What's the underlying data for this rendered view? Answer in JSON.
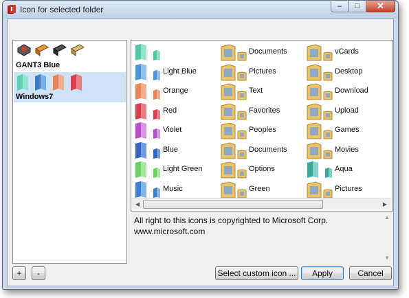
{
  "window": {
    "title": "Icon for selected folder",
    "minimize": "–",
    "maximize": "□",
    "close": "✕"
  },
  "themes": [
    {
      "name": "GANT3 Blue",
      "selected": false
    },
    {
      "name": "Windows7",
      "selected": true
    }
  ],
  "icon_grid": [
    {
      "label": "",
      "icon": "folder-teal-icon"
    },
    {
      "label": "Documents",
      "icon": "folder-documents-icon"
    },
    {
      "label": "vCards",
      "icon": "folder-vcards-icon"
    },
    {
      "label": "Light Blue",
      "icon": "folder-lightblue-icon"
    },
    {
      "label": "Pictures",
      "icon": "folder-pictures-icon"
    },
    {
      "label": "Desktop",
      "icon": "folder-desktop-icon"
    },
    {
      "label": "Orange",
      "icon": "folder-orange-icon"
    },
    {
      "label": "Text",
      "icon": "folder-text-icon"
    },
    {
      "label": "Download",
      "icon": "folder-download-icon"
    },
    {
      "label": "Red",
      "icon": "folder-red-icon"
    },
    {
      "label": "Favorites",
      "icon": "folder-favorites-icon"
    },
    {
      "label": "Upload",
      "icon": "folder-upload-icon"
    },
    {
      "label": "Violet",
      "icon": "folder-violet-icon"
    },
    {
      "label": "Peoples",
      "icon": "folder-peoples-icon"
    },
    {
      "label": "Games",
      "icon": "folder-games-icon"
    },
    {
      "label": "Blue",
      "icon": "folder-blue-icon"
    },
    {
      "label": "Documents",
      "icon": "folder-documents-icon"
    },
    {
      "label": "Movies",
      "icon": "folder-movies-icon"
    },
    {
      "label": "Light Green",
      "icon": "folder-lightgreen-icon"
    },
    {
      "label": "Options",
      "icon": "folder-options-icon"
    },
    {
      "label": "Aqua",
      "icon": "folder-aqua-icon"
    },
    {
      "label": "Music",
      "icon": "folder-music-icon"
    },
    {
      "label": "Green",
      "icon": "folder-green-icon"
    },
    {
      "label": "Pictures",
      "icon": "folder-pictures-icon"
    }
  ],
  "description": {
    "line1": "All right to this icons is copyrighted to Microsoft Corp.",
    "line2": "www.microsoft.com"
  },
  "buttons": {
    "add": "+",
    "remove": "-",
    "custom": "Select custom icon ...",
    "apply": "Apply",
    "cancel": "Cancel"
  },
  "colors": {
    "selection": "#cfe3f7",
    "title_bar": "#c9d7e7",
    "close_button": "#c4432a"
  }
}
